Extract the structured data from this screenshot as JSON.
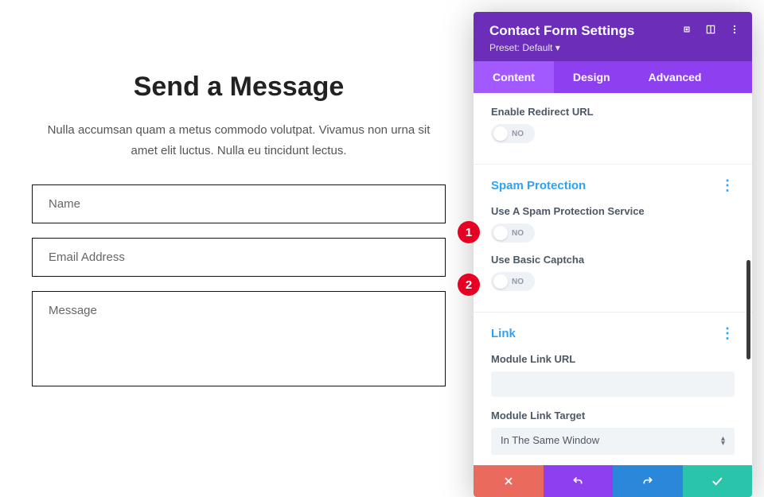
{
  "preview": {
    "heading": "Send a Message",
    "body_text": "Nulla accumsan quam a metus commodo volutpat. Vivamus non urna sit amet elit luctus. Nulla eu tincidunt lectus.",
    "name_placeholder": "Name",
    "email_placeholder": "Email Address",
    "message_placeholder": "Message"
  },
  "panel": {
    "title": "Contact Form Settings",
    "subtitle": "Preset: Default ▾",
    "tabs": {
      "content": "Content",
      "design": "Design",
      "advanced": "Advanced"
    },
    "options": {
      "enable_redirect_label": "Enable Redirect URL",
      "toggle_no": "NO",
      "spam_title": "Spam Protection",
      "use_spam_label": "Use A Spam Protection Service",
      "use_captcha_label": "Use Basic Captcha",
      "link_title": "Link",
      "module_link_url_label": "Module Link URL",
      "module_link_target_label": "Module Link Target",
      "module_link_target_value": "In The Same Window"
    }
  },
  "callouts": {
    "one": "1",
    "two": "2"
  }
}
